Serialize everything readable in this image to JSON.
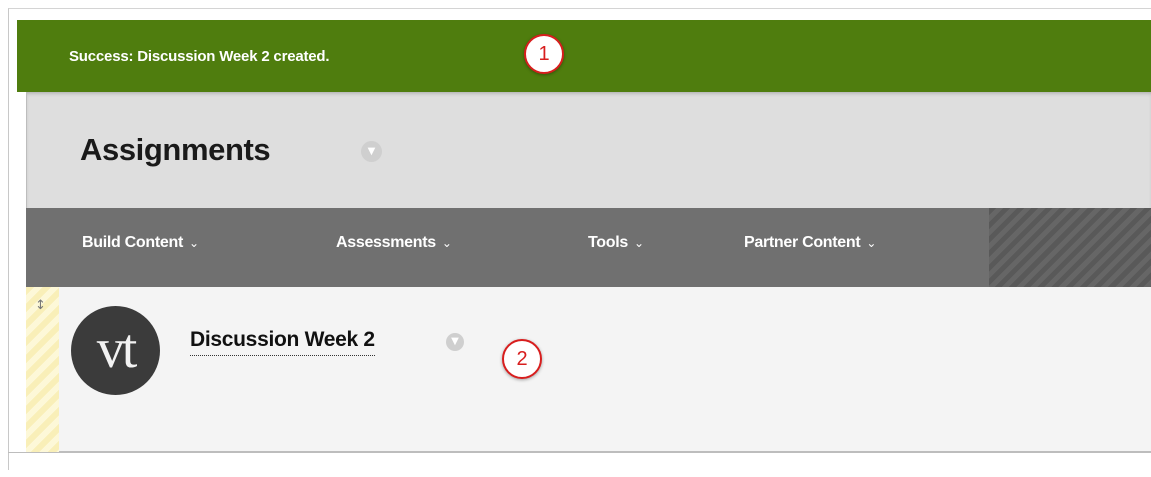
{
  "notification": {
    "message": "Success: Discussion Week 2 created."
  },
  "callouts": {
    "first": "1",
    "second": "2"
  },
  "page": {
    "title": "Assignments"
  },
  "action_bar": {
    "items": [
      {
        "label": "Build Content"
      },
      {
        "label": "Assessments"
      },
      {
        "label": "Tools"
      },
      {
        "label": "Partner Content"
      }
    ]
  },
  "content": {
    "item_title": "Discussion Week 2",
    "logo_text": "vt"
  },
  "icons": {
    "menu_caret": "chevron-down-icon",
    "title_options": "chevron-down-circle-icon",
    "drag": "vertical-resize-icon"
  },
  "colors": {
    "success_green": "#4f7d0e",
    "action_bar_gray": "#707070",
    "callout_red": "#d81e1e",
    "content_bg": "#f4f4f4"
  }
}
